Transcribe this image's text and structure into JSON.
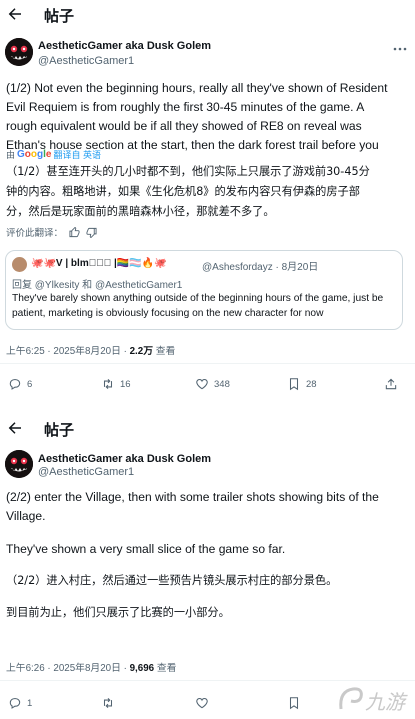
{
  "topbar": {
    "title": "帖子"
  },
  "post1": {
    "author_name": "AestheticGamer aka Dusk Golem",
    "author_handle": "@AestheticGamer1",
    "body_en": [
      "(1/2) Not even the beginning hours, really all they've shown of Resident",
      "Evil Requiem is from roughly the first 30-45 minutes of the game. A",
      "rough equivalent would be if all they showed of RE8 on reveal was",
      "Ethan's house section at the start, then the dark forest trail before you"
    ],
    "translate": {
      "prefix": "由",
      "brand": "Google",
      "action": "翻译自 英语"
    },
    "body_zh": [
      "（1/2）甚至连开头的几小时都不到，他们实际上只展示了游戏前30-45分",
      "钟的内容。粗略地讲，如果《生化危机8》的发布内容只有伊森的房子部",
      "分，然后是玩家面前的黑暗森林小径，那就差不多了。"
    ],
    "rate_label": "评价此翻译：",
    "quote": {
      "name": "🐙🐙V | blm🏽🏾🏿 |🏳️‍🌈🏳️‍⚧️🔥🐙",
      "handle_date": "@Ashesfordayz · 8月20日",
      "reply_to": "回复 @Ylkesity 和 @AestheticGamer1",
      "text": "They've barely shown anything outside of the beginning hours of the game, just be patient, marketing is obviously focusing on the new character for now"
    },
    "meta": {
      "time": "上午6:25 · 2025年8月20日 · ",
      "views": "2.2万",
      "views_label": " 查看"
    },
    "actions": {
      "replies": "6",
      "reposts": "16",
      "likes": "348",
      "bookmarks": "28"
    }
  },
  "post2": {
    "author_name": "AestheticGamer aka Dusk Golem",
    "author_handle": "@AestheticGamer1",
    "body_en": [
      "(2/2) enter the Village, then with some trailer shots showing bits of the",
      "Village.",
      "",
      "They've shown a very small slice of the game so far."
    ],
    "body_zh": [
      "（2/2）进入村庄，然后通过一些预告片镜头展示村庄的部分景色。",
      "",
      "到目前为止，他们只展示了比赛的一小部分。"
    ],
    "meta": {
      "time": "上午6:26 · 2025年8月20日 · ",
      "views": "9,696",
      "views_label": " 查看"
    },
    "actions": {
      "replies": "1",
      "reposts": "",
      "likes": "",
      "bookmarks": ""
    }
  },
  "watermark": {
    "text": "九游"
  },
  "icons": [
    "back-arrow-icon",
    "more-icon",
    "google-icon",
    "thumbs-up-icon",
    "thumbs-down-icon",
    "reply-icon",
    "repost-icon",
    "like-icon",
    "bookmark-icon",
    "share-icon"
  ],
  "colors": {
    "link": "#1d9bf0",
    "secondary": "#536471",
    "border": "#cfd9de"
  }
}
